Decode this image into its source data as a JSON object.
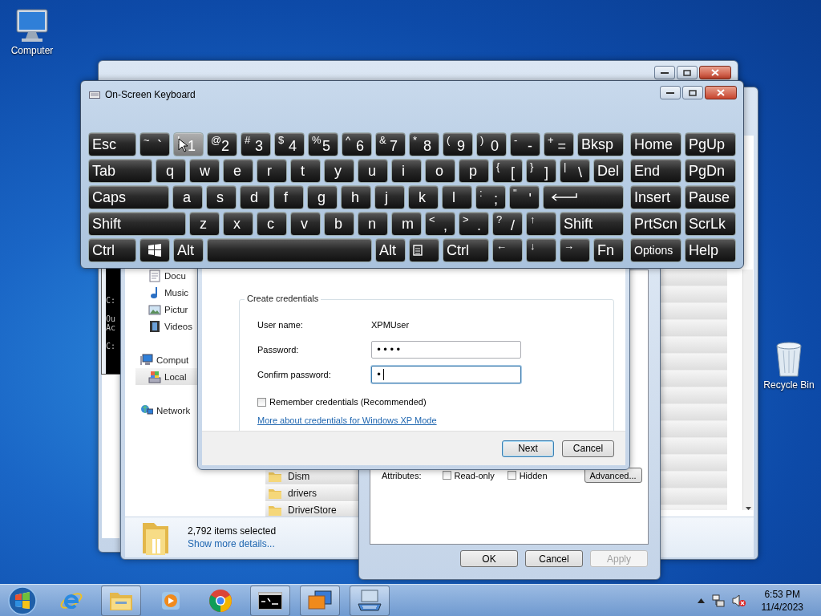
{
  "desktop_icons": [
    {
      "label": "Computer",
      "kind": "computer"
    },
    {
      "label": "Recycle Bin",
      "kind": "recycle-bin"
    }
  ],
  "command_prompt": {
    "lines": [
      "C:",
      "Ou",
      "Ac",
      "C:"
    ]
  },
  "explorer": {
    "nav_items": [
      {
        "label": "Docu",
        "kind": "documents",
        "selected": false
      },
      {
        "label": "Music",
        "kind": "music",
        "selected": false
      },
      {
        "label": "Pictur",
        "kind": "pictures",
        "selected": false
      },
      {
        "label": "Videos",
        "kind": "videos",
        "selected": false
      },
      {
        "label": "Comput",
        "kind": "computer",
        "selected": false
      },
      {
        "label": "Local",
        "kind": "drive",
        "selected": true
      },
      {
        "label": "Network",
        "kind": "network",
        "selected": false
      }
    ],
    "files": [
      {
        "name": "Dism",
        "selected": true
      },
      {
        "name": "drivers",
        "selected": true
      },
      {
        "name": "DriverStore",
        "selected": true
      }
    ],
    "status": {
      "summary": "2,792 items selected",
      "link": "Show more details..."
    }
  },
  "properties": {
    "attributes_label": "Attributes:",
    "attributes": [
      {
        "label": "Read-only",
        "checked": false
      },
      {
        "label": "Hidden",
        "checked": false
      }
    ],
    "advanced_button": "Advanced...",
    "buttons": [
      {
        "label": "OK",
        "disabled": false
      },
      {
        "label": "Cancel",
        "disabled": false
      },
      {
        "label": "Apply",
        "disabled": true
      }
    ]
  },
  "credentials_dialog": {
    "group_title": "Create credentials",
    "fields": [
      {
        "label": "User name:",
        "value": "XPMUser",
        "kind": "text"
      },
      {
        "label": "Password:",
        "value": "••••",
        "kind": "password",
        "focused": false
      },
      {
        "label": "Confirm password:",
        "value": "•",
        "kind": "password",
        "focused": true
      }
    ],
    "remember": {
      "label": "Remember credentials (Recommended)",
      "checked": false
    },
    "link": "More about credentials for Windows XP Mode",
    "buttons": [
      {
        "label": "Next",
        "default": true
      },
      {
        "label": "Cancel",
        "default": false
      }
    ]
  },
  "on_screen_keyboard": {
    "title": "On-Screen Keyboard",
    "key_rows": [
      {
        "keys": [
          {
            "kind": "word",
            "main": "Esc",
            "highlighted": false
          },
          {
            "kind": "char",
            "top": "~",
            "main": "`",
            "highlighted": false
          },
          {
            "kind": "char",
            "top": "!",
            "main": "1",
            "highlighted": true
          },
          {
            "kind": "char",
            "top": "@",
            "main": "2",
            "highlighted": false
          },
          {
            "kind": "char",
            "top": "#",
            "main": "3",
            "highlighted": false
          },
          {
            "kind": "char",
            "top": "$",
            "main": "4",
            "highlighted": false
          },
          {
            "kind": "char",
            "top": "%",
            "main": "5",
            "highlighted": false
          },
          {
            "kind": "char",
            "top": "^",
            "main": "6",
            "highlighted": false
          },
          {
            "kind": "char",
            "top": "&",
            "main": "7",
            "highlighted": false
          },
          {
            "kind": "char",
            "top": "*",
            "main": "8",
            "highlighted": false
          },
          {
            "kind": "char",
            "top": "(",
            "main": "9",
            "highlighted": false
          },
          {
            "kind": "char",
            "top": ")",
            "main": "0",
            "highlighted": false
          },
          {
            "kind": "char",
            "top": "-",
            "main": "-",
            "highlighted": false
          },
          {
            "kind": "char",
            "top": "+",
            "main": "=",
            "highlighted": false
          },
          {
            "kind": "word",
            "main": "Bksp",
            "highlighted": false
          }
        ]
      },
      {
        "keys": [
          {
            "kind": "word",
            "main": "Tab",
            "highlighted": false
          },
          {
            "kind": "letter",
            "main": "q",
            "highlighted": false
          },
          {
            "kind": "letter",
            "main": "w",
            "highlighted": false
          },
          {
            "kind": "letter",
            "main": "e",
            "highlighted": false
          },
          {
            "kind": "letter",
            "main": "r",
            "highlighted": false
          },
          {
            "kind": "letter",
            "main": "t",
            "highlighted": false
          },
          {
            "kind": "letter",
            "main": "y",
            "highlighted": false
          },
          {
            "kind": "letter",
            "main": "u",
            "highlighted": false
          },
          {
            "kind": "letter",
            "main": "i",
            "highlighted": false
          },
          {
            "kind": "letter",
            "main": "o",
            "highlighted": false
          },
          {
            "kind": "letter",
            "main": "p",
            "highlighted": false
          },
          {
            "kind": "char",
            "top": "{",
            "main": "[",
            "highlighted": false
          },
          {
            "kind": "char",
            "top": "}",
            "main": "]",
            "highlighted": false
          },
          {
            "kind": "char",
            "top": "|",
            "main": "\\",
            "highlighted": false
          },
          {
            "kind": "word",
            "main": "Del",
            "highlighted": false
          }
        ]
      },
      {
        "keys": [
          {
            "kind": "word",
            "main": "Caps",
            "highlighted": false
          },
          {
            "kind": "letter",
            "main": "a",
            "highlighted": false
          },
          {
            "kind": "letter",
            "main": "s",
            "highlighted": false
          },
          {
            "kind": "letter",
            "main": "d",
            "highlighted": false
          },
          {
            "kind": "letter",
            "main": "f",
            "highlighted": false
          },
          {
            "kind": "letter",
            "main": "g",
            "highlighted": false
          },
          {
            "kind": "letter",
            "main": "h",
            "highlighted": false
          },
          {
            "kind": "letter",
            "main": "j",
            "highlighted": false
          },
          {
            "kind": "letter",
            "main": "k",
            "highlighted": false
          },
          {
            "kind": "letter",
            "main": "l",
            "highlighted": false
          },
          {
            "kind": "char",
            "top": ":",
            "main": ";",
            "highlighted": false
          },
          {
            "kind": "char",
            "top": "\"",
            "main": "'",
            "highlighted": false
          },
          {
            "kind": "enter",
            "highlighted": false
          }
        ]
      },
      {
        "keys": [
          {
            "kind": "word",
            "main": "Shift",
            "highlighted": false
          },
          {
            "kind": "letter",
            "main": "z",
            "highlighted": false
          },
          {
            "kind": "letter",
            "main": "x",
            "highlighted": false
          },
          {
            "kind": "letter",
            "main": "c",
            "highlighted": false
          },
          {
            "kind": "letter",
            "main": "v",
            "highlighted": false
          },
          {
            "kind": "letter",
            "main": "b",
            "highlighted": false
          },
          {
            "kind": "letter",
            "main": "n",
            "highlighted": false
          },
          {
            "kind": "letter",
            "main": "m",
            "highlighted": false
          },
          {
            "kind": "char",
            "top": "<",
            "main": ",",
            "highlighted": false
          },
          {
            "kind": "char",
            "top": ">",
            "main": ".",
            "highlighted": false
          },
          {
            "kind": "char",
            "top": "?",
            "main": "/",
            "highlighted": false
          },
          {
            "kind": "char",
            "top": "↑",
            "highlighted": false
          },
          {
            "kind": "word",
            "main": "Shift",
            "highlighted": false
          }
        ]
      },
      {
        "keys": [
          {
            "kind": "word",
            "main": "Ctrl",
            "highlighted": false
          },
          {
            "kind": "windows",
            "highlighted": false
          },
          {
            "kind": "word",
            "main": "Alt",
            "highlighted": false
          },
          {
            "kind": "space",
            "highlighted": false
          },
          {
            "kind": "word",
            "main": "Alt",
            "highlighted": false
          },
          {
            "kind": "menu",
            "highlighted": false
          },
          {
            "kind": "word",
            "main": "Ctrl",
            "highlighted": false
          },
          {
            "kind": "char",
            "top": "←",
            "highlighted": false
          },
          {
            "kind": "char",
            "top": "↓",
            "highlighted": false
          },
          {
            "kind": "char",
            "top": "→",
            "highlighted": false
          },
          {
            "kind": "word",
            "main": "Fn",
            "highlighted": false
          }
        ]
      }
    ],
    "navigation_key_rows": [
      {
        "keys": [
          {
            "kind": "word",
            "main": "Home",
            "highlighted": false
          },
          {
            "kind": "word",
            "main": "PgUp",
            "highlighted": false
          }
        ]
      },
      {
        "keys": [
          {
            "kind": "word",
            "main": "End",
            "highlighted": false
          },
          {
            "kind": "word",
            "main": "PgDn",
            "highlighted": false
          }
        ]
      },
      {
        "keys": [
          {
            "kind": "word",
            "main": "Insert",
            "highlighted": false
          },
          {
            "kind": "word",
            "main": "Pause",
            "highlighted": false
          }
        ]
      },
      {
        "keys": [
          {
            "kind": "word",
            "main": "PrtScn",
            "highlighted": false
          },
          {
            "kind": "word",
            "main": "ScrLk",
            "highlighted": false
          }
        ]
      },
      {
        "keys": [
          {
            "kind": "small-word",
            "main": "Options",
            "highlighted": false
          },
          {
            "kind": "word",
            "main": "Help",
            "highlighted": false
          }
        ]
      }
    ]
  },
  "taskbar": {
    "items": [
      {
        "kind": "ie",
        "running": false
      },
      {
        "kind": "explorer",
        "running": true
      },
      {
        "kind": "media",
        "running": false
      },
      {
        "kind": "chrome",
        "running": false
      },
      {
        "kind": "cmd",
        "running": true
      },
      {
        "kind": "virtual-pc",
        "running": true
      },
      {
        "kind": "keyboard",
        "running": true
      }
    ],
    "clock": {
      "time": "6:53 PM",
      "date": "11/4/2023"
    }
  }
}
